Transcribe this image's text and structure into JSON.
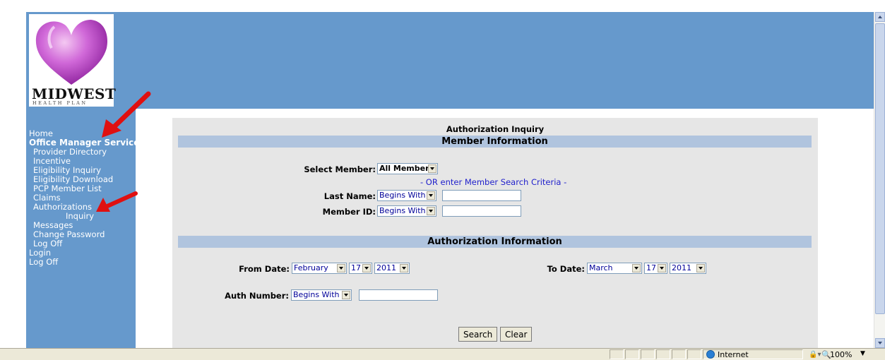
{
  "logo": {
    "name": "MIDWEST",
    "subtitle": "HEALTH PLAN"
  },
  "sidebar": {
    "items": [
      {
        "label": "Home"
      },
      {
        "label": "Office Manager Services"
      },
      {
        "label": "Provider Directory"
      },
      {
        "label": "Incentive"
      },
      {
        "label": "Eligibility Inquiry"
      },
      {
        "label": "Eligibility Download"
      },
      {
        "label": "PCP Member List"
      },
      {
        "label": "Claims"
      },
      {
        "label": "Authorizations"
      },
      {
        "label": "Inquiry"
      },
      {
        "label": "Messages"
      },
      {
        "label": "Change Password"
      },
      {
        "label": "Log Off"
      },
      {
        "label": "Login"
      },
      {
        "label": "Log Off"
      }
    ]
  },
  "form": {
    "title": "Authorization Inquiry",
    "member_section": "Member Information",
    "select_member_label": "Select Member:",
    "select_member_value": "All Members",
    "or_text": "- OR enter Member Search Criteria -",
    "last_name_label": "Last Name:",
    "last_name_mode": "Begins With",
    "last_name_value": "",
    "member_id_label": "Member ID:",
    "member_id_mode": "Begins With",
    "member_id_value": "",
    "auth_section": "Authorization Information",
    "from_date_label": "From Date:",
    "from_month": "February",
    "from_day": "17",
    "from_year": "2011",
    "to_date_label": "To Date:",
    "to_month": "March",
    "to_day": "17",
    "to_year": "2011",
    "auth_number_label": "Auth Number:",
    "auth_number_mode": "Begins With",
    "auth_number_value": "",
    "search_button": "Search",
    "clear_button": "Clear"
  },
  "statusbar": {
    "zone": "Internet",
    "zoom": "100%"
  },
  "colors": {
    "header_blue": "#6699cc",
    "section_bar": "#b0c4de",
    "panel_bg": "#e6e6e6",
    "annotation_red": "#e01010"
  }
}
